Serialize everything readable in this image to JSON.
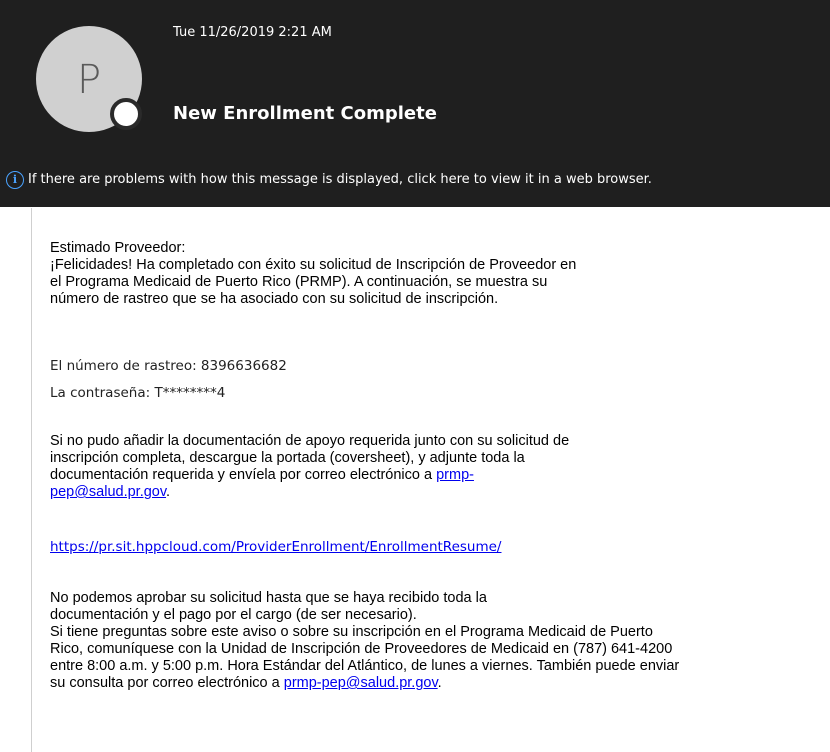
{
  "header": {
    "avatar_initial": "P",
    "date": "Tue 11/26/2019 2:21 AM",
    "subject": "New Enrollment Complete",
    "info_icon": "info-icon",
    "info_text": "If there are problems with how this message is displayed, click here to view it in a web browser."
  },
  "body": {
    "greeting": "Estimado Proveedor:",
    "para1": [
      "¡Felicidades! Ha completado con éxito su solicitud de Inscripción de Proveedor en",
      "el Programa Medicaid de Puerto Rico (PRMP). A continuación, se muestra su",
      "número de rastreo que se ha asociado con su solicitud de inscripción."
    ],
    "tracking_line": "El número de rastreo: 8396636682",
    "password_line": "La contraseña: T********4",
    "para2": [
      "Si no pudo añadir la documentación de apoyo requerida junto con su solicitud de",
      "inscripción completa, descargue la portada (coversheet), y adjunte toda la",
      "documentación requerida y envíela por correo electrónico a "
    ],
    "email_link_part1": "prmp-",
    "email_link_part2": "pep@salud.pr.gov",
    "period": ".",
    "url_link": "https://pr.sit.hppcloud.com/ProviderEnrollment/EnrollmentResume/",
    "para3": [
      "No podemos aprobar su solicitud hasta que se haya recibido toda la",
      "documentación y el pago por el cargo (de ser necesario).",
      "Si tiene preguntas sobre este aviso o sobre su inscripción en el Programa Medicaid de Puerto",
      "Rico, comuníquese con la Unidad de Inscripción de Proveedores de Medicaid en (787) 641-4200",
      "entre 8:00 a.m. y 5:00 p.m. Hora Estándar del Atlántico, de lunes a viernes. También puede enviar",
      "su consulta por correo electrónico a "
    ],
    "email_link_full": "prmp-pep@salud.pr.gov"
  },
  "colors": {
    "header_bg": "#1f1f1f",
    "link": "#0000ee",
    "info_accent": "#4aa3ff"
  }
}
